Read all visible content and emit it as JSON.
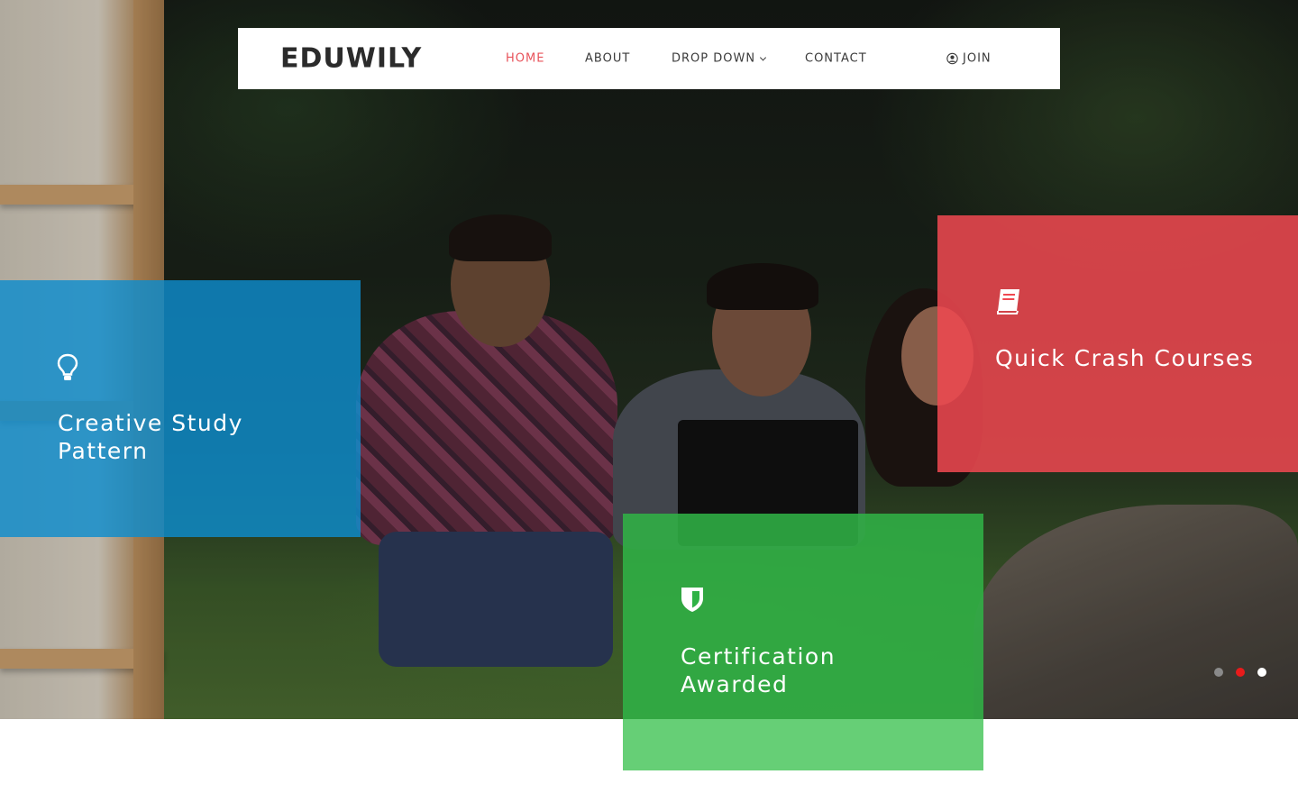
{
  "brand": {
    "name": "EDUWILY"
  },
  "nav": {
    "items": [
      {
        "label": "HOME",
        "active": true
      },
      {
        "label": "ABOUT",
        "active": false
      },
      {
        "label": "DROP DOWN",
        "active": false
      },
      {
        "label": "CONTACT",
        "active": false
      }
    ],
    "join_label": "JOIN"
  },
  "features": [
    {
      "title": "Creative Study Pattern",
      "icon": "lightbulb-icon",
      "color": "#0e8ccd"
    },
    {
      "title": "Quick Crash Courses",
      "icon": "book-icon",
      "color": "#f04850"
    },
    {
      "title": "Certification Awarded",
      "icon": "shield-icon",
      "color": "#30b246"
    }
  ],
  "slider": {
    "dots": [
      {
        "color": "#8a8a8a",
        "active": false
      },
      {
        "color": "#e81b1b",
        "active": true
      },
      {
        "color": "#ffffff",
        "active": false
      }
    ]
  },
  "colors": {
    "accent": "#e8525a",
    "nav_text": "#3a3a3a",
    "logo": "#2b2b2b"
  }
}
